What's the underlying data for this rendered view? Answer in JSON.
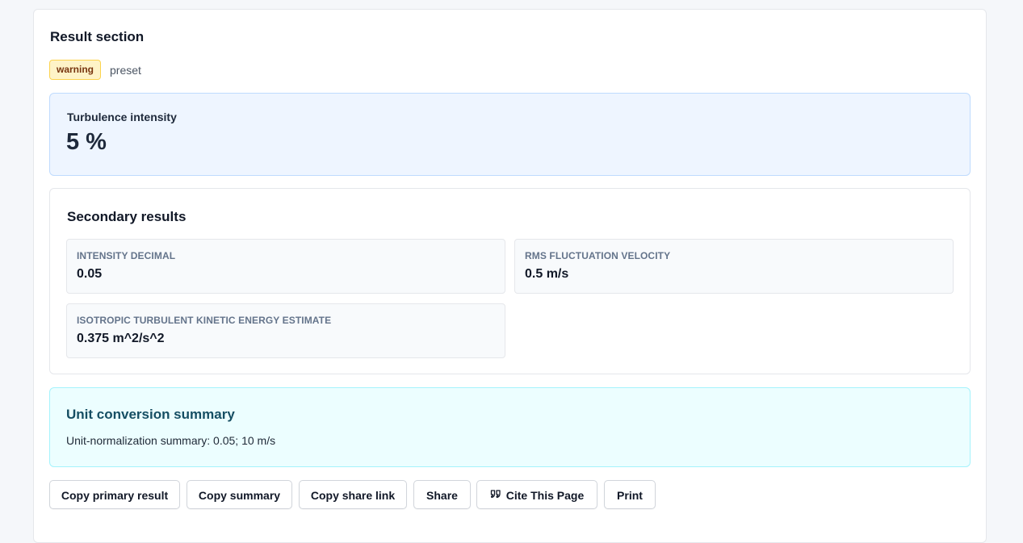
{
  "result": {
    "title": "Result section",
    "badge": "warning",
    "preset": "preset"
  },
  "primary": {
    "label": "Turbulence intensity",
    "value": "5 %"
  },
  "secondary": {
    "title": "Secondary results",
    "items": [
      {
        "label": "INTENSITY DECIMAL",
        "value": "0.05"
      },
      {
        "label": "RMS FLUCTUATION VELOCITY",
        "value": "0.5 m/s"
      },
      {
        "label": "ISOTROPIC TURBULENT KINETIC ENERGY ESTIMATE",
        "value": "0.375 m^2/s^2"
      }
    ]
  },
  "conversion": {
    "title": "Unit conversion summary",
    "text": "Unit-normalization summary: 0.05; 10 m/s"
  },
  "actions": {
    "copy_primary": "Copy primary result",
    "copy_summary": "Copy summary",
    "copy_share_link": "Copy share link",
    "share": "Share",
    "cite": "Cite This Page",
    "cite_icon": "quote-icon",
    "print": "Print"
  },
  "colors": {
    "warning_bg": "#fef3c7",
    "primary_bg": "#eef5ff",
    "conversion_bg": "#ecfeff"
  }
}
